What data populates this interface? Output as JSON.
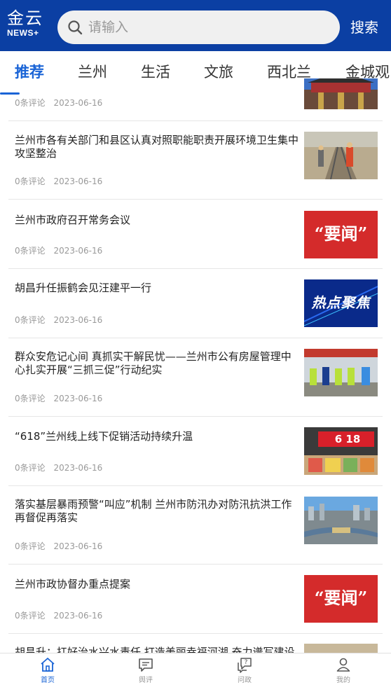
{
  "header": {
    "logo_top": "金云",
    "logo_bottom": "NEWS+",
    "search_placeholder": "请输入",
    "search_button": "搜索"
  },
  "tabs": [
    {
      "label": "推荐",
      "active": true
    },
    {
      "label": "兰州"
    },
    {
      "label": "生活"
    },
    {
      "label": "文旅"
    },
    {
      "label": "西北兰"
    },
    {
      "label": "金城观"
    }
  ],
  "colors": {
    "brand": "#0b3fa3",
    "accent": "#1a64d6",
    "news_red": "#d42b2b"
  },
  "feed": [
    {
      "title": "",
      "comments": "0条评论",
      "date": "2023-06-16",
      "thumb": "temple-photo"
    },
    {
      "title": "兰州市各有关部门和县区认真对照职能职责开展环境卫生集中攻坚整治",
      "comments": "0条评论",
      "date": "2023-06-16",
      "thumb": "railway-workers-photo"
    },
    {
      "title": "兰州市政府召开常务会议",
      "comments": "0条评论",
      "date": "2023-06-16",
      "thumb": "news-label",
      "thumb_text": "“要闻”"
    },
    {
      "title": "胡昌升任振鹤会见汪建平一行",
      "comments": "0条评论",
      "date": "2023-06-16",
      "thumb": "hot-focus-graphic",
      "thumb_text": "热点聚焦"
    },
    {
      "title": "群众安危记心间 真抓实干解民忧——兰州市公有房屋管理中心扎实开展“三抓三促”行动纪实",
      "comments": "0条评论",
      "date": "2023-06-16",
      "thumb": "volunteers-photo"
    },
    {
      "title": "“618”兰州线上线下促销活动持续升温",
      "comments": "0条评论",
      "date": "2023-06-16",
      "thumb": "supermarket-photo",
      "thumb_text": "6 18"
    },
    {
      "title": "落实基层暴雨预警“叫应”机制 兰州市防汛办对防汛抗洪工作再督促再落实",
      "comments": "0条评论",
      "date": "2023-06-16",
      "thumb": "city-aerial-photo"
    },
    {
      "title": "兰州市政协督办重点提案",
      "comments": "0条评论",
      "date": "2023-06-16",
      "thumb": "news-label",
      "thumb_text": "“要闻”"
    },
    {
      "title": "胡昌升：扛好治水兴水责任 打造美丽幸福河湖 奋力谱写建设",
      "comments": "",
      "date": "",
      "thumb": "partial-photo"
    }
  ],
  "tabbar": [
    {
      "label": "首页",
      "icon": "home-icon",
      "active": true
    },
    {
      "label": "舆评",
      "icon": "comment-icon"
    },
    {
      "label": "问政",
      "icon": "question-icon"
    },
    {
      "label": "我的",
      "icon": "user-icon"
    }
  ]
}
